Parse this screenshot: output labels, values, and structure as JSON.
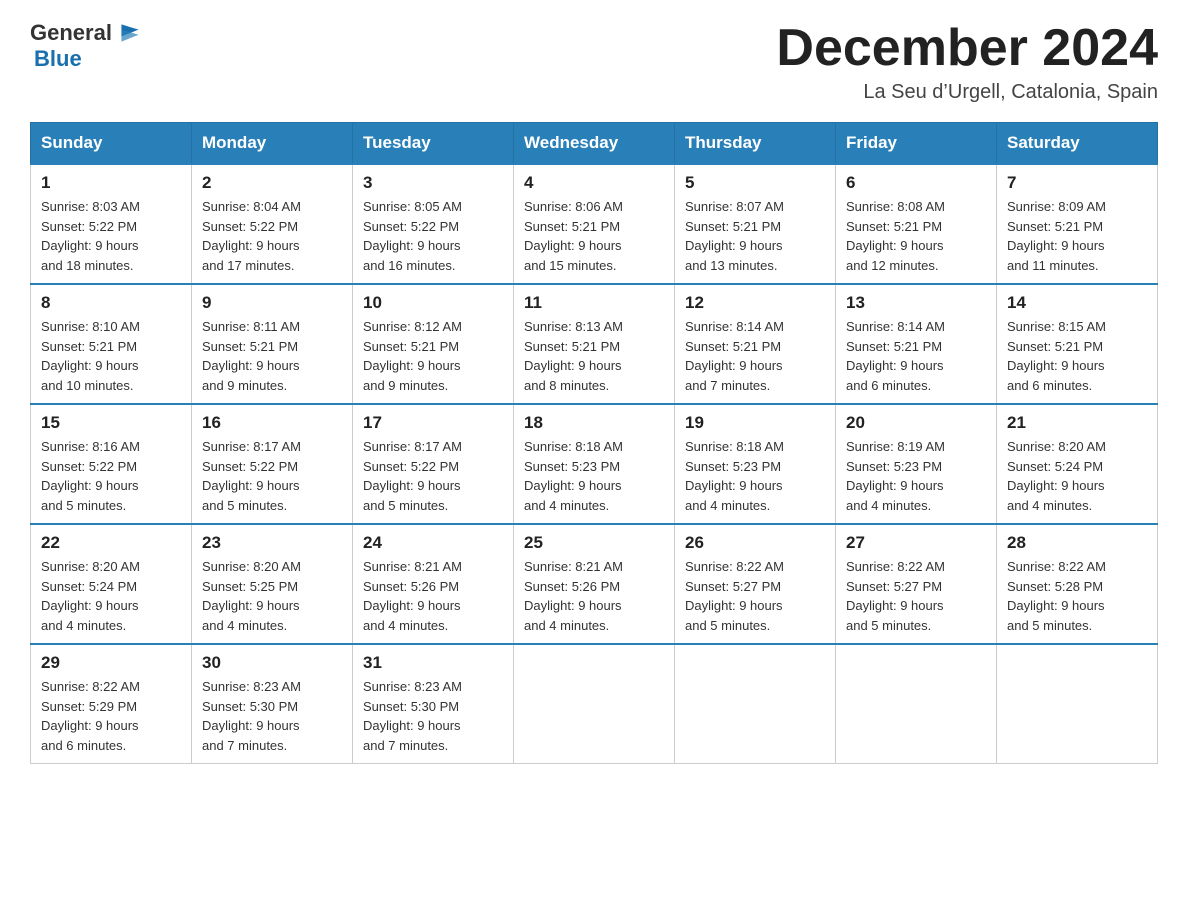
{
  "header": {
    "logo_general": "General",
    "logo_blue": "Blue",
    "month_title": "December 2024",
    "subtitle": "La Seu d’Urgell, Catalonia, Spain"
  },
  "days_of_week": [
    "Sunday",
    "Monday",
    "Tuesday",
    "Wednesday",
    "Thursday",
    "Friday",
    "Saturday"
  ],
  "weeks": [
    [
      {
        "day": "1",
        "sunrise": "8:03 AM",
        "sunset": "5:22 PM",
        "daylight": "9 hours and 18 minutes."
      },
      {
        "day": "2",
        "sunrise": "8:04 AM",
        "sunset": "5:22 PM",
        "daylight": "9 hours and 17 minutes."
      },
      {
        "day": "3",
        "sunrise": "8:05 AM",
        "sunset": "5:22 PM",
        "daylight": "9 hours and 16 minutes."
      },
      {
        "day": "4",
        "sunrise": "8:06 AM",
        "sunset": "5:21 PM",
        "daylight": "9 hours and 15 minutes."
      },
      {
        "day": "5",
        "sunrise": "8:07 AM",
        "sunset": "5:21 PM",
        "daylight": "9 hours and 13 minutes."
      },
      {
        "day": "6",
        "sunrise": "8:08 AM",
        "sunset": "5:21 PM",
        "daylight": "9 hours and 12 minutes."
      },
      {
        "day": "7",
        "sunrise": "8:09 AM",
        "sunset": "5:21 PM",
        "daylight": "9 hours and 11 minutes."
      }
    ],
    [
      {
        "day": "8",
        "sunrise": "8:10 AM",
        "sunset": "5:21 PM",
        "daylight": "9 hours and 10 minutes."
      },
      {
        "day": "9",
        "sunrise": "8:11 AM",
        "sunset": "5:21 PM",
        "daylight": "9 hours and 9 minutes."
      },
      {
        "day": "10",
        "sunrise": "8:12 AM",
        "sunset": "5:21 PM",
        "daylight": "9 hours and 9 minutes."
      },
      {
        "day": "11",
        "sunrise": "8:13 AM",
        "sunset": "5:21 PM",
        "daylight": "9 hours and 8 minutes."
      },
      {
        "day": "12",
        "sunrise": "8:14 AM",
        "sunset": "5:21 PM",
        "daylight": "9 hours and 7 minutes."
      },
      {
        "day": "13",
        "sunrise": "8:14 AM",
        "sunset": "5:21 PM",
        "daylight": "9 hours and 6 minutes."
      },
      {
        "day": "14",
        "sunrise": "8:15 AM",
        "sunset": "5:21 PM",
        "daylight": "9 hours and 6 minutes."
      }
    ],
    [
      {
        "day": "15",
        "sunrise": "8:16 AM",
        "sunset": "5:22 PM",
        "daylight": "9 hours and 5 minutes."
      },
      {
        "day": "16",
        "sunrise": "8:17 AM",
        "sunset": "5:22 PM",
        "daylight": "9 hours and 5 minutes."
      },
      {
        "day": "17",
        "sunrise": "8:17 AM",
        "sunset": "5:22 PM",
        "daylight": "9 hours and 5 minutes."
      },
      {
        "day": "18",
        "sunrise": "8:18 AM",
        "sunset": "5:23 PM",
        "daylight": "9 hours and 4 minutes."
      },
      {
        "day": "19",
        "sunrise": "8:18 AM",
        "sunset": "5:23 PM",
        "daylight": "9 hours and 4 minutes."
      },
      {
        "day": "20",
        "sunrise": "8:19 AM",
        "sunset": "5:23 PM",
        "daylight": "9 hours and 4 minutes."
      },
      {
        "day": "21",
        "sunrise": "8:20 AM",
        "sunset": "5:24 PM",
        "daylight": "9 hours and 4 minutes."
      }
    ],
    [
      {
        "day": "22",
        "sunrise": "8:20 AM",
        "sunset": "5:24 PM",
        "daylight": "9 hours and 4 minutes."
      },
      {
        "day": "23",
        "sunrise": "8:20 AM",
        "sunset": "5:25 PM",
        "daylight": "9 hours and 4 minutes."
      },
      {
        "day": "24",
        "sunrise": "8:21 AM",
        "sunset": "5:26 PM",
        "daylight": "9 hours and 4 minutes."
      },
      {
        "day": "25",
        "sunrise": "8:21 AM",
        "sunset": "5:26 PM",
        "daylight": "9 hours and 4 minutes."
      },
      {
        "day": "26",
        "sunrise": "8:22 AM",
        "sunset": "5:27 PM",
        "daylight": "9 hours and 5 minutes."
      },
      {
        "day": "27",
        "sunrise": "8:22 AM",
        "sunset": "5:27 PM",
        "daylight": "9 hours and 5 minutes."
      },
      {
        "day": "28",
        "sunrise": "8:22 AM",
        "sunset": "5:28 PM",
        "daylight": "9 hours and 5 minutes."
      }
    ],
    [
      {
        "day": "29",
        "sunrise": "8:22 AM",
        "sunset": "5:29 PM",
        "daylight": "9 hours and 6 minutes."
      },
      {
        "day": "30",
        "sunrise": "8:23 AM",
        "sunset": "5:30 PM",
        "daylight": "9 hours and 7 minutes."
      },
      {
        "day": "31",
        "sunrise": "8:23 AM",
        "sunset": "5:30 PM",
        "daylight": "9 hours and 7 minutes."
      },
      null,
      null,
      null,
      null
    ]
  ]
}
